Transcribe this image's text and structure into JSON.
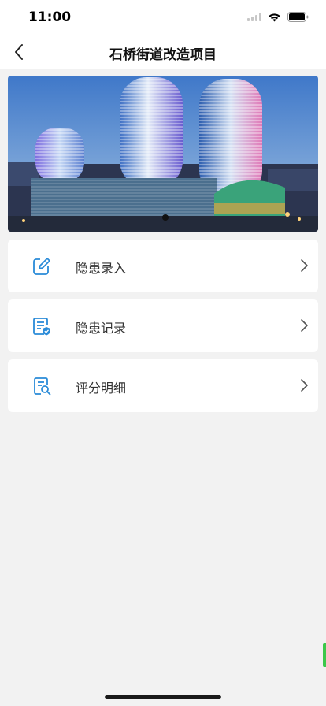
{
  "status_bar": {
    "time": "11:00"
  },
  "nav": {
    "title": "石桥街道改造项目"
  },
  "banner": {
    "page_count": 1,
    "active_page": 1
  },
  "menu": [
    {
      "label": "隐患录入",
      "icon": "edit-icon"
    },
    {
      "label": "隐患记录",
      "icon": "record-shield-icon"
    },
    {
      "label": "评分明细",
      "icon": "document-search-icon"
    }
  ],
  "colors": {
    "accent": "#2a8bd8",
    "background": "#f2f2f2",
    "edge_tab": "#3cc84a"
  }
}
